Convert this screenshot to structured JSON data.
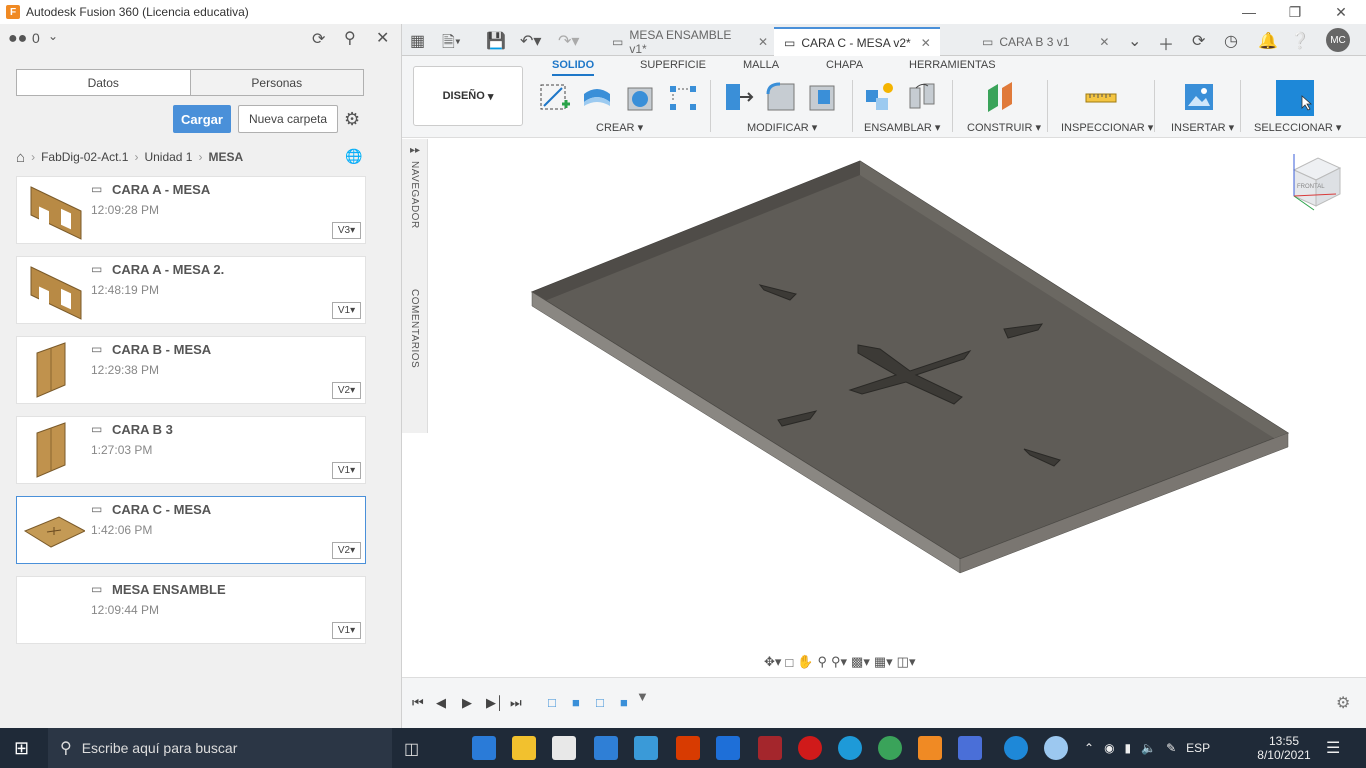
{
  "window": {
    "title": "Autodesk Fusion 360 (Licencia educativa)",
    "app_icon_letter": "F"
  },
  "left_panel": {
    "notif_count": "0",
    "tabs": [
      "Datos",
      "Personas"
    ],
    "upload_label": "Cargar",
    "new_folder_label": "Nueva carpeta",
    "breadcrumb": [
      "FabDig-02-Act.1",
      "Unidad 1",
      "MESA"
    ],
    "files": [
      {
        "name": "CARA A - MESA",
        "time": "12:09:28 PM",
        "version": "V3"
      },
      {
        "name": "CARA A - MESA 2.",
        "time": "12:48:19 PM",
        "version": "V1"
      },
      {
        "name": "CARA B - MESA",
        "time": "12:29:38 PM",
        "version": "V2"
      },
      {
        "name": "CARA B 3",
        "time": "1:27:03 PM",
        "version": "V1"
      },
      {
        "name": "CARA C - MESA",
        "time": "1:42:06 PM",
        "version": "V2"
      },
      {
        "name": "MESA ENSAMBLE",
        "time": "12:09:44 PM",
        "version": "V1"
      }
    ]
  },
  "doc_tabs": [
    {
      "label": "MESA ENSAMBLE v1*"
    },
    {
      "label": "CARA C - MESA v2*"
    },
    {
      "label": "CARA B 3 v1"
    }
  ],
  "user_initials": "MC",
  "toolbar": {
    "workspace": "DISEÑO",
    "tabs": [
      "SOLIDO",
      "SUPERFICIE",
      "MALLA",
      "CHAPA",
      "HERRAMIENTAS"
    ],
    "groups": [
      "CREAR",
      "MODIFICAR",
      "ENSAMBLAR",
      "CONSTRUIR",
      "INSPECCIONAR",
      "INSERTAR",
      "SELECCIONAR"
    ]
  },
  "side_labels": {
    "browser": "NAVEGADOR",
    "comments": "COMENTARIOS"
  },
  "viewcube_label": "FRONTAL",
  "taskbar": {
    "search_placeholder": "Escribe aquí para buscar",
    "language": "ESP",
    "time": "13:55",
    "date": "8/10/2021"
  },
  "colors": {
    "accent": "#4a90d9",
    "model_face": "#5f5c57",
    "taskbar": "#1f2a38"
  }
}
